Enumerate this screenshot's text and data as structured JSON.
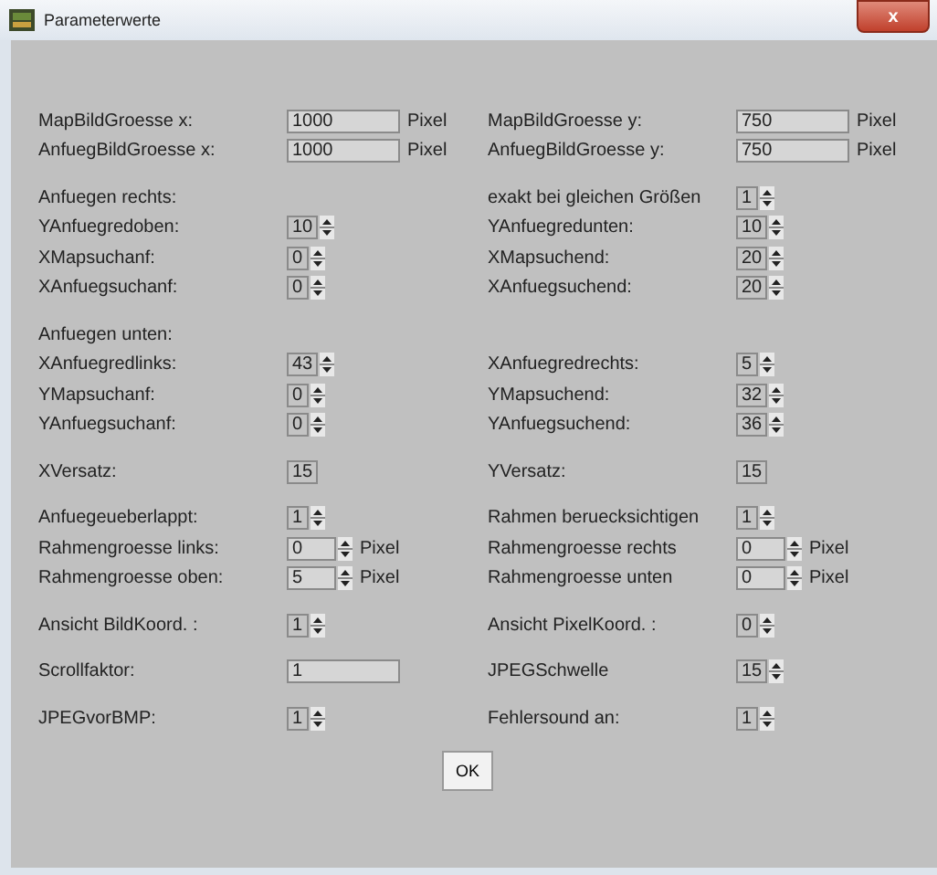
{
  "window": {
    "title": "Parameterwerte",
    "close": "x"
  },
  "groups": [
    [
      {
        "left": {
          "label": "MapBildGroesse x:",
          "field": {
            "kind": "text",
            "value": "1000",
            "unit": "Pixel"
          }
        },
        "right": {
          "label": "MapBildGroesse y:",
          "field": {
            "kind": "text",
            "value": "750",
            "unit": "Pixel"
          }
        }
      },
      {
        "left": {
          "label": "AnfuegBildGroesse x:",
          "field": {
            "kind": "text",
            "value": "1000",
            "unit": "Pixel"
          }
        },
        "right": {
          "label": "AnfuegBildGroesse y:",
          "field": {
            "kind": "text",
            "value": "750",
            "unit": "Pixel"
          }
        }
      }
    ],
    [
      {
        "left": {
          "label": "Anfuegen rechts:"
        },
        "right": {
          "label": "exakt bei gleichen Größen",
          "field": {
            "kind": "spin",
            "value": "1"
          }
        }
      },
      {
        "left": {
          "label": "YAnfuegredoben:",
          "field": {
            "kind": "spin",
            "value": "10"
          }
        },
        "right": {
          "label": "YAnfuegredunten:",
          "field": {
            "kind": "spin",
            "value": "10"
          }
        }
      },
      {
        "left": {
          "label": "XMapsuchanf:",
          "field": {
            "kind": "spin",
            "value": "0"
          }
        },
        "right": {
          "label": "XMapsuchend:",
          "field": {
            "kind": "spin",
            "value": "20"
          }
        }
      },
      {
        "left": {
          "label": "XAnfuegsuchanf:",
          "field": {
            "kind": "spin",
            "value": "0"
          }
        },
        "right": {
          "label": "XAnfuegsuchend:",
          "field": {
            "kind": "spin",
            "value": "20"
          }
        }
      }
    ],
    [
      {
        "left": {
          "label": "Anfuegen unten:"
        }
      },
      {
        "left": {
          "label": "XAnfuegredlinks:",
          "field": {
            "kind": "spin",
            "value": "43"
          }
        },
        "right": {
          "label": "XAnfuegredrechts:",
          "field": {
            "kind": "spin",
            "value": "5"
          }
        }
      },
      {
        "left": {
          "label": "YMapsuchanf:",
          "field": {
            "kind": "spin",
            "value": "0"
          }
        },
        "right": {
          "label": "YMapsuchend:",
          "field": {
            "kind": "spin",
            "value": "32"
          }
        }
      },
      {
        "left": {
          "label": "YAnfuegsuchanf:",
          "field": {
            "kind": "spin",
            "value": "0"
          }
        },
        "right": {
          "label": "YAnfuegsuchend:",
          "field": {
            "kind": "spin",
            "value": "36"
          }
        }
      }
    ],
    [
      {
        "left": {
          "label": "XVersatz:",
          "field": {
            "kind": "box",
            "value": "15"
          }
        },
        "right": {
          "label": "YVersatz:",
          "field": {
            "kind": "box",
            "value": "15"
          }
        }
      }
    ],
    [
      {
        "left": {
          "label": "Anfuegeueberlappt:",
          "field": {
            "kind": "spin",
            "value": "1"
          }
        },
        "right": {
          "label": "Rahmen beruecksichtigen",
          "field": {
            "kind": "spin",
            "value": "1"
          }
        }
      },
      {
        "left": {
          "label": "Rahmengroesse links:",
          "field": {
            "kind": "widespin",
            "value": "0",
            "unit": "Pixel"
          }
        },
        "right": {
          "label": "Rahmengroesse rechts",
          "field": {
            "kind": "widespin",
            "value": "0",
            "unit": "Pixel"
          }
        }
      },
      {
        "left": {
          "label": "Rahmengroesse oben:",
          "field": {
            "kind": "widespin",
            "value": "5",
            "unit": "Pixel"
          }
        },
        "right": {
          "label": "Rahmengroesse unten",
          "field": {
            "kind": "widespin",
            "value": "0",
            "unit": "Pixel"
          }
        }
      }
    ],
    [
      {
        "left": {
          "label": "Ansicht BildKoord. :",
          "field": {
            "kind": "spin",
            "value": "1"
          }
        },
        "right": {
          "label": "Ansicht PixelKoord. :",
          "field": {
            "kind": "spin",
            "value": "0"
          }
        }
      }
    ],
    [
      {
        "left": {
          "label": "Scrollfaktor:",
          "field": {
            "kind": "text",
            "value": "1"
          }
        },
        "right": {
          "label": "JPEGSchwelle",
          "field": {
            "kind": "spin",
            "value": "15"
          }
        }
      }
    ],
    [
      {
        "left": {
          "label": "JPEGvorBMP:",
          "field": {
            "kind": "spin",
            "value": "1"
          }
        },
        "right": {
          "label": "Fehlersound an:",
          "field": {
            "kind": "spin",
            "value": "1"
          }
        }
      }
    ]
  ],
  "ok_button": "OK"
}
